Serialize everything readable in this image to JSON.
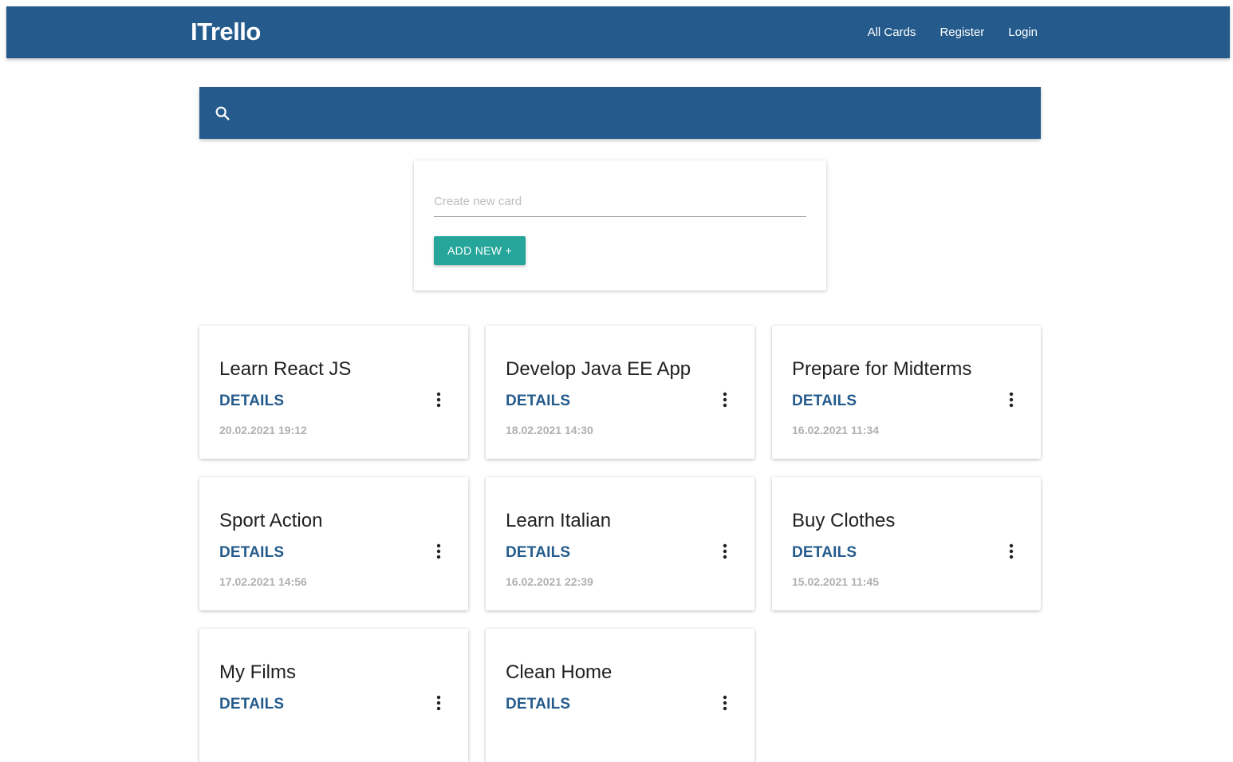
{
  "header": {
    "brand": "ITrello",
    "nav": [
      {
        "label": "All Cards"
      },
      {
        "label": "Register"
      },
      {
        "label": "Login"
      }
    ],
    "color": "#245b8c"
  },
  "search": {
    "icon": "search-icon",
    "value": ""
  },
  "create": {
    "placeholder": "Create new card",
    "value": "",
    "button_label": "ADD NEW +",
    "button_color": "#26a69a"
  },
  "cards": [
    {
      "title": "Learn React JS",
      "details_label": "DETAILS",
      "date": "20.02.2021 19:12",
      "menu_icon": "more-vert-icon"
    },
    {
      "title": "Develop Java EE App",
      "details_label": "DETAILS",
      "date": "18.02.2021 14:30",
      "menu_icon": "more-vert-icon"
    },
    {
      "title": "Prepare for Midterms",
      "details_label": "DETAILS",
      "date": "16.02.2021 11:34",
      "menu_icon": "more-vert-icon"
    },
    {
      "title": "Sport Action",
      "details_label": "DETAILS",
      "date": "17.02.2021 14:56",
      "menu_icon": "more-vert-icon"
    },
    {
      "title": "Learn Italian",
      "details_label": "DETAILS",
      "date": "16.02.2021 22:39",
      "menu_icon": "more-vert-icon"
    },
    {
      "title": "Buy Clothes",
      "details_label": "DETAILS",
      "date": "15.02.2021 11:45",
      "menu_icon": "more-vert-icon"
    },
    {
      "title": "My Films",
      "details_label": "DETAILS",
      "date": "",
      "menu_icon": "more-vert-icon"
    },
    {
      "title": "Clean Home",
      "details_label": "DETAILS",
      "date": "",
      "menu_icon": "more-vert-icon"
    }
  ]
}
